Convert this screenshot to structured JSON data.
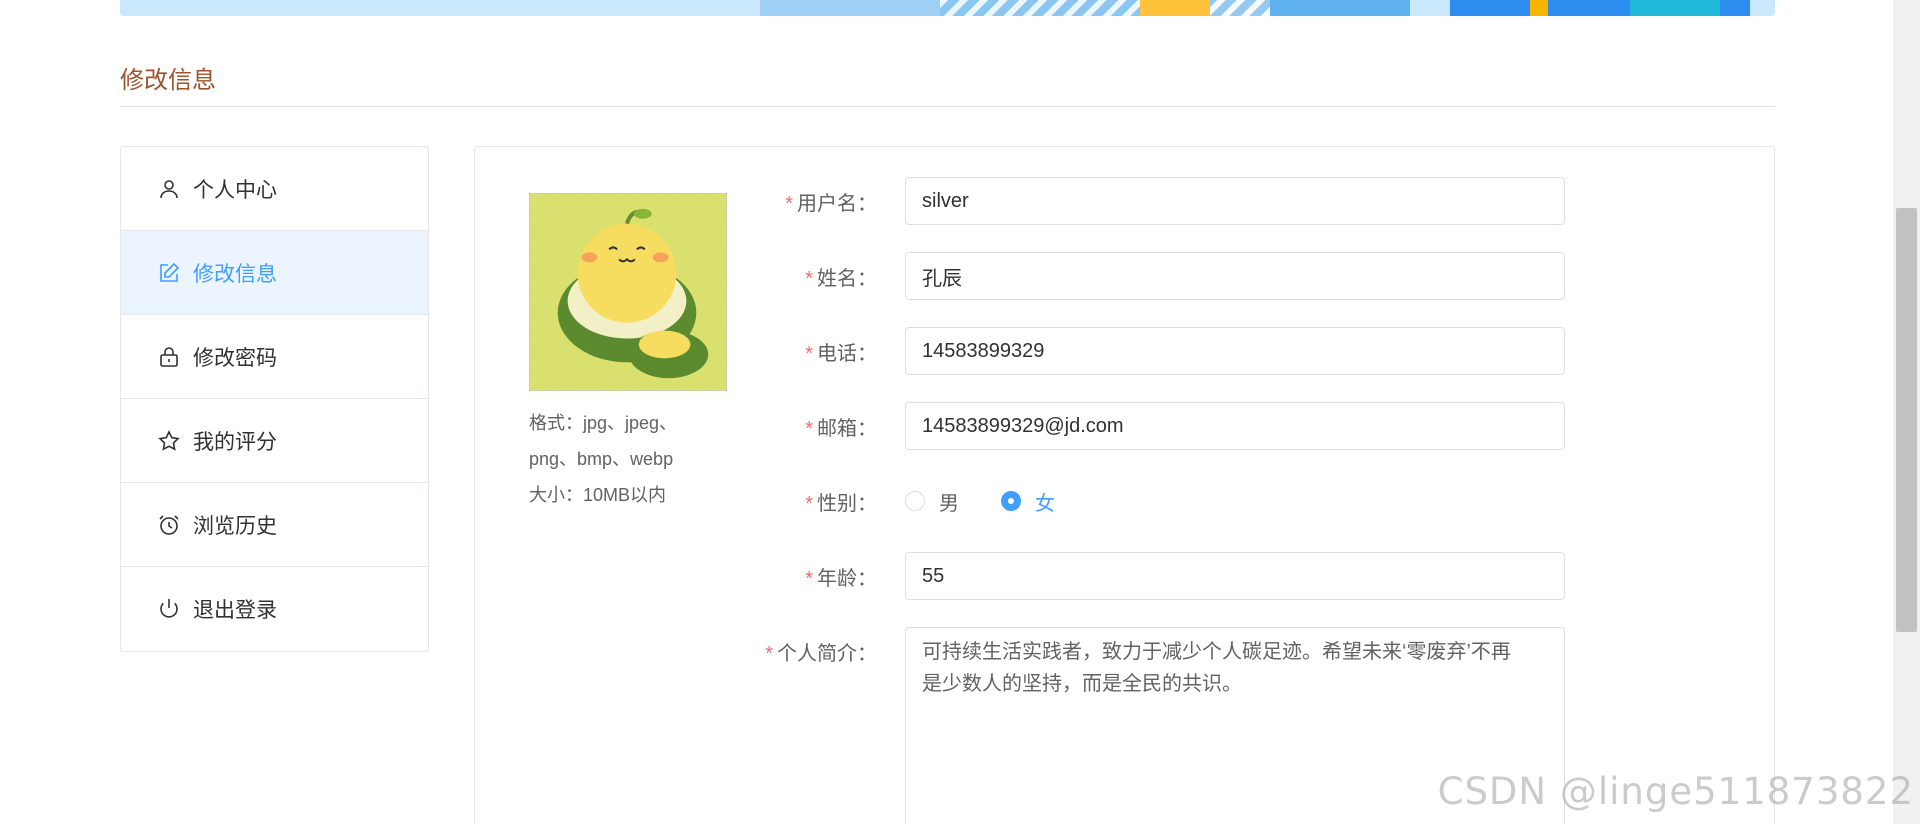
{
  "section": {
    "title": "修改信息"
  },
  "sidebar": {
    "items": [
      {
        "label": "个人中心",
        "icon": "user-icon",
        "active": false
      },
      {
        "label": "修改信息",
        "icon": "edit-icon",
        "active": true
      },
      {
        "label": "修改密码",
        "icon": "lock-icon",
        "active": false
      },
      {
        "label": "我的评分",
        "icon": "star-icon",
        "active": false
      },
      {
        "label": "浏览历史",
        "icon": "alarm-clock-icon",
        "active": false
      },
      {
        "label": "退出登录",
        "icon": "power-icon",
        "active": false
      }
    ]
  },
  "avatar": {
    "tip_line1": "格式：jpg、jpeg、",
    "tip_line2": "png、bmp、webp",
    "tip_line3": "大小：10MB以内"
  },
  "form": {
    "required_mark": "*",
    "username": {
      "label": "用户名：",
      "value": "silver"
    },
    "name": {
      "label": "姓名：",
      "value": "孔辰"
    },
    "phone": {
      "label": "电话：",
      "value": "14583899329"
    },
    "email": {
      "label": "邮箱：",
      "value": "14583899329@jd.com"
    },
    "gender": {
      "label": "性别：",
      "options": [
        "男",
        "女"
      ],
      "selected": "女"
    },
    "age": {
      "label": "年龄：",
      "value": "55"
    },
    "bio": {
      "label": "个人简介：",
      "value": "可持续生活实践者，致力于减少个人碳足迹。希望未来‘零废弃’不再是少数人的坚持，而是全民的共识。"
    }
  },
  "watermark": "CSDN @linge511873822",
  "colors": {
    "accent": "#409eff",
    "active_bg": "#ecf5ff",
    "title": "#a0522d",
    "required": "#f56c6c",
    "border": "#dcdfe6"
  }
}
